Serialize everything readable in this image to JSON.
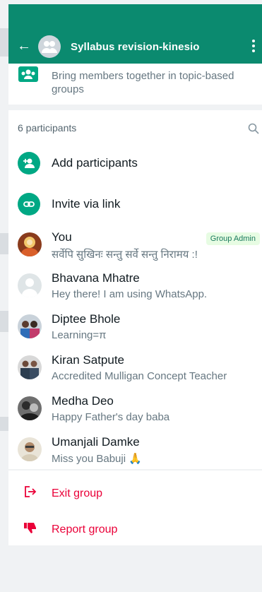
{
  "header": {
    "title": "Syllabus revision-kinesio"
  },
  "community": {
    "description": "Bring members together in topic-based groups"
  },
  "participants": {
    "count_label": "6 participants",
    "actions": [
      {
        "label": "Add participants"
      },
      {
        "label": "Invite via link"
      }
    ],
    "members": [
      {
        "name": "You",
        "status": "सर्वेपि सुखिनः सन्तु सर्वे सन्तु निरामय :!",
        "badge": "Group Admin"
      },
      {
        "name": "Bhavana Mhatre",
        "status": "Hey there! I am using WhatsApp."
      },
      {
        "name": "Diptee Bhole",
        "status": "Learning=π"
      },
      {
        "name": "Kiran Satpute",
        "status": "Accredited Mulligan Concept Teacher"
      },
      {
        "name": "Medha Deo",
        "status": "Happy Father's day baba"
      },
      {
        "name": "Umanjali Damke",
        "status": "Miss you Babuji 🙏"
      }
    ]
  },
  "danger": {
    "exit_label": "Exit group",
    "report_label": "Report group"
  },
  "colors": {
    "header": "#0b8a6f",
    "accent": "#00a884",
    "danger": "#ea0038"
  }
}
